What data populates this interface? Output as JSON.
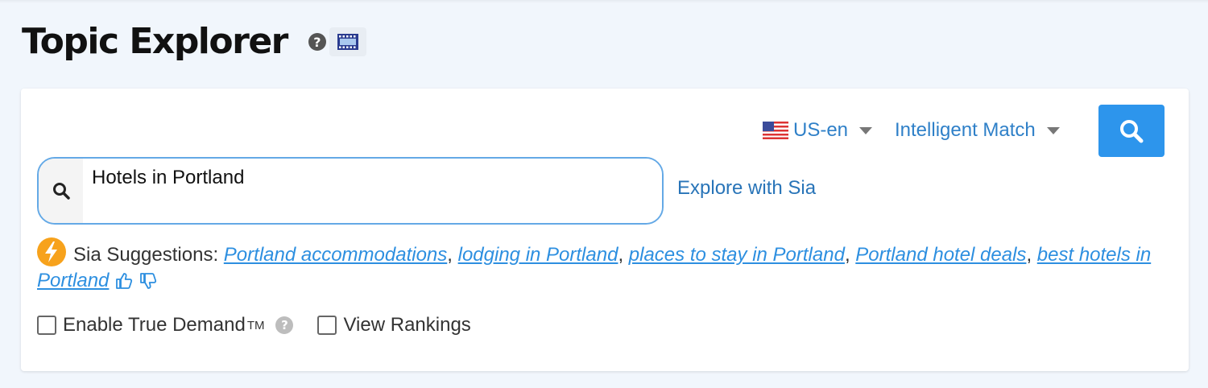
{
  "header": {
    "title": "Topic Explorer",
    "help_icon": "question-circle-icon",
    "video_icon": "film-icon"
  },
  "toolbar": {
    "locale_label": "US-en",
    "locale_flag": "us-flag-icon",
    "match_label": "Intelligent Match",
    "search_button_icon": "search-icon"
  },
  "search": {
    "value": "Hotels in Portland",
    "explore_link": "Explore with Sia"
  },
  "suggestions": {
    "label": "Sia Suggestions:",
    "items": [
      "Portland accommodations",
      "lodging in Portland",
      "places to stay in Portland",
      "Portland hotel deals",
      "best hotels in Portland"
    ]
  },
  "options": {
    "true_demand_label": "Enable True Demand",
    "trademark": "TM",
    "view_rankings_label": "View Rankings",
    "true_demand_checked": false,
    "view_rankings_checked": false
  },
  "colors": {
    "accent": "#2d95ec",
    "link": "#2d8fe0",
    "bolt": "#f7a21c"
  }
}
